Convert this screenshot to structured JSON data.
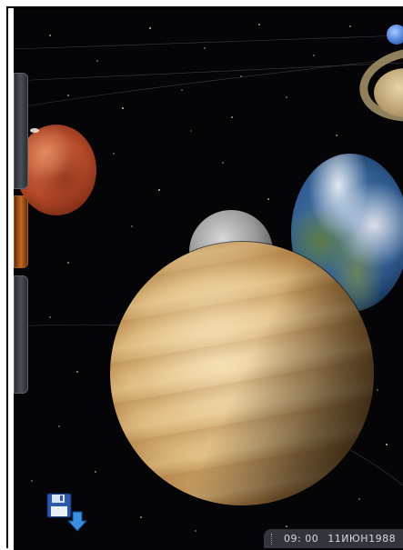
{
  "status": {
    "time": "09: 00",
    "date": "11ИЮН1988"
  },
  "toolbar": {
    "save_icon": "save-disk-icon"
  },
  "colors": {
    "background": "#050507",
    "status_bar": "#3c3e46",
    "status_text": "#d8d8d8"
  }
}
